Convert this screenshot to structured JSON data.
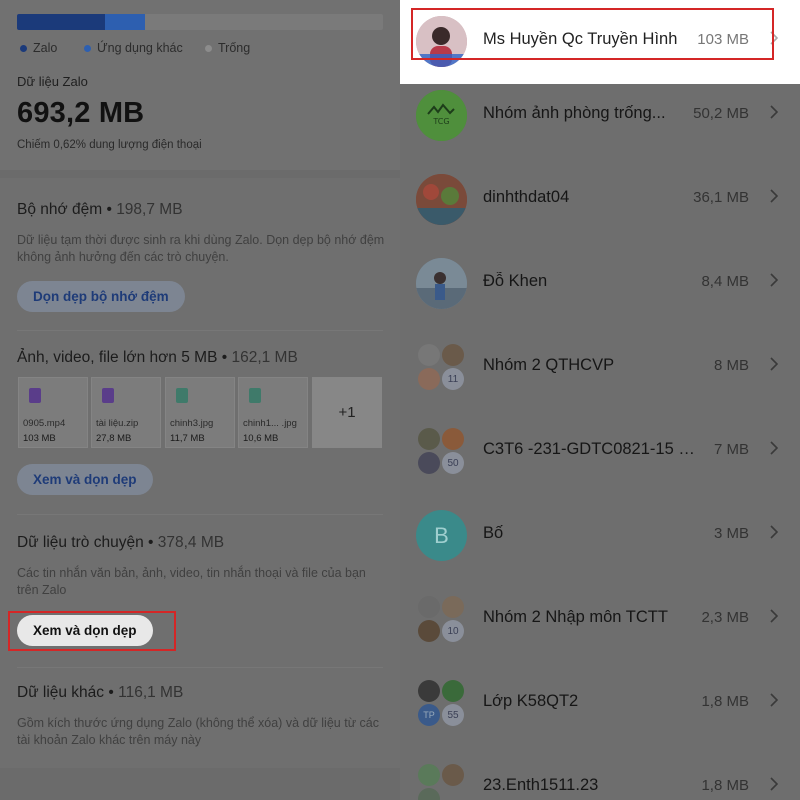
{
  "storage": {
    "usage_fraction_zalo": 0.24,
    "usage_fraction_other_apps": 0.11,
    "legend": [
      {
        "label": "Zalo",
        "color": "#1b3a7a"
      },
      {
        "label": "Ứng dụng khác",
        "color": "#2d5fb0"
      },
      {
        "label": "Trống",
        "color": "#8c8c8c"
      }
    ],
    "zalo_data_label": "Dữ liệu Zalo",
    "zalo_data_total": "693,2 MB",
    "share_note": "Chiếm 0,62% dung lượng điện thoại"
  },
  "cache": {
    "title": "Bộ nhớ đệm",
    "size": "198,7 MB",
    "description": "Dữ liệu tạm thời được sinh ra khi dùng Zalo. Dọn dẹp bộ nhớ đệm không ảnh hưởng đến các trò chuyện.",
    "button": "Dọn dẹp bộ nhớ đệm"
  },
  "large_files": {
    "title": "Ảnh, video, file lớn hơn 5 MB",
    "size": "162,1 MB",
    "files": [
      {
        "name": "0905.mp4",
        "size": "103 MB",
        "icon": "video-file-icon",
        "color": "#5a3d8a"
      },
      {
        "name": "tài liệu.zip",
        "size": "27,8 MB",
        "icon": "zip-file-icon",
        "color": "#5a3d8a"
      },
      {
        "name": "chinh3.jpg",
        "size": "11,7 MB",
        "icon": "image-file-icon",
        "color": "#3f7a6a"
      },
      {
        "name": "chinh1... .jpg",
        "size": "10,6 MB",
        "icon": "image-file-icon",
        "color": "#3f7a6a"
      }
    ],
    "more": "+1",
    "button": "Xem và dọn dẹp"
  },
  "chat_data": {
    "title": "Dữ liệu trò chuyện",
    "size": "378,4 MB",
    "description": "Các tin nhắn văn bản, ảnh, video, tin nhắn thoại và file của bạn trên Zalo",
    "button": "Xem và dọn dẹp"
  },
  "other_data": {
    "title": "Dữ liệu khác",
    "size": "116,1 MB",
    "description": "Gồm kích thước ứng dụng Zalo (không thể xóa) và dữ liệu từ các tài khoản Zalo khác trên máy này"
  },
  "conversations": [
    {
      "name": "Ms Huyền Qc Truyền Hình",
      "size": "103 MB",
      "avatar": "photo-avatar",
      "color": "#c9a0a8",
      "highlighted": true
    },
    {
      "name": "Nhóm ảnh phòng trống...",
      "size": "50,2 MB",
      "avatar": "logo-avatar",
      "color": "#4a8a3a",
      "logo_text": "TCG"
    },
    {
      "name": "dinhthdat04",
      "size": "36,1 MB",
      "avatar": "photo-avatar",
      "color": "#8a4a3a"
    },
    {
      "name": "Đỗ Khen",
      "size": "8,4 MB",
      "avatar": "photo-avatar",
      "color": "#6a7a8a"
    },
    {
      "name": "Nhóm 2 QTHCVP",
      "size": "8 MB",
      "avatar": "group-avatar",
      "count": "11",
      "colors": [
        "#777777",
        "#6a5a4a",
        "#8a6a5a"
      ]
    },
    {
      "name": "C3T6 -231-GDTC0821-15 B...",
      "size": "7 MB",
      "avatar": "group-avatar",
      "count": "50",
      "colors": [
        "#5a5a4a",
        "#8a5a3a",
        "#4a4a5a"
      ]
    },
    {
      "name": "Bố",
      "size": "3 MB",
      "avatar": "letter-avatar",
      "letter": "B",
      "color": "#3a8a8a"
    },
    {
      "name": "Nhóm 2 Nhập môn TCTT",
      "size": "2,3 MB",
      "avatar": "group-avatar",
      "count": "10",
      "colors": [
        "#6a6a6a",
        "#7a6a5a",
        "#5a4a3a"
      ]
    },
    {
      "name": "Lớp K58QT2",
      "size": "1,8 MB",
      "avatar": "group-avatar",
      "count": "55",
      "colors": [
        "#3a3a3a",
        "#3a6a3a",
        "#3a5a8a"
      ],
      "third_text": "TP"
    },
    {
      "name": "23.Enth1511.23",
      "size": "1,8 MB",
      "avatar": "group-avatar",
      "colors": [
        "#5a7a5a",
        "#6a5a4a",
        "#5a6a5a"
      ]
    }
  ]
}
